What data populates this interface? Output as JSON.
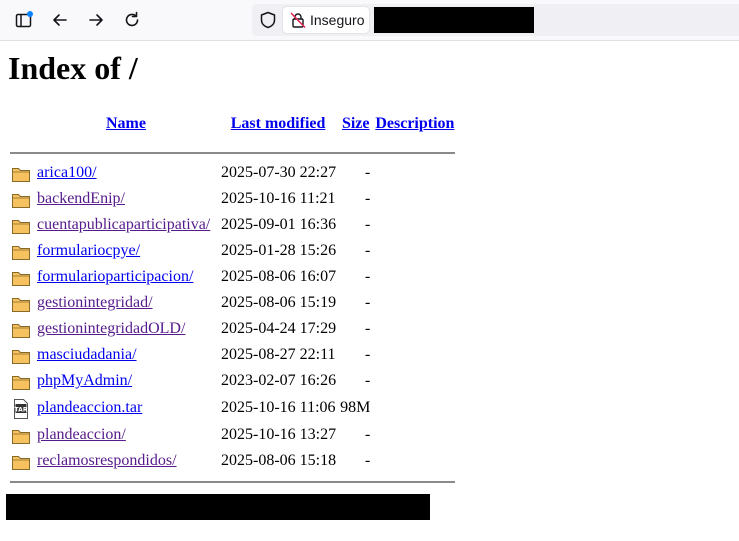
{
  "browser": {
    "security_label": "Inseguro"
  },
  "page": {
    "title": "Index of /"
  },
  "columns": {
    "name": "Name",
    "last_modified": "Last modified",
    "size": "Size",
    "description": "Description"
  },
  "entries": [
    {
      "name": "arica100/",
      "modified": "2025-07-30 22:27",
      "size": "-",
      "icon": "folder-icon",
      "visited": false
    },
    {
      "name": "backendEnip/",
      "modified": "2025-10-16 11:21",
      "size": "-",
      "icon": "folder-icon",
      "visited": true
    },
    {
      "name": "cuentapublicaparticipativa/",
      "modified": "2025-09-01 16:36",
      "size": "-",
      "icon": "folder-icon",
      "visited": true
    },
    {
      "name": "formulariocpye/",
      "modified": "2025-01-28 15:26",
      "size": "-",
      "icon": "folder-icon",
      "visited": false
    },
    {
      "name": "formularioparticipacion/",
      "modified": "2025-08-06 16:07",
      "size": "-",
      "icon": "folder-icon",
      "visited": false
    },
    {
      "name": "gestionintegridad/",
      "modified": "2025-08-06 15:19",
      "size": "-",
      "icon": "folder-icon",
      "visited": true
    },
    {
      "name": "gestionintegridadOLD/",
      "modified": "2025-04-24 17:29",
      "size": "-",
      "icon": "folder-icon",
      "visited": true
    },
    {
      "name": "masciudadania/",
      "modified": "2025-08-27 22:11",
      "size": "-",
      "icon": "folder-icon",
      "visited": false
    },
    {
      "name": "phpMyAdmin/",
      "modified": "2023-02-07 16:26",
      "size": "-",
      "icon": "folder-icon",
      "visited": false
    },
    {
      "name": "plandeaccion.tar",
      "modified": "2025-10-16 11:06",
      "size": "98M",
      "icon": "tar-file-icon",
      "visited": false
    },
    {
      "name": "plandeaccion/",
      "modified": "2025-10-16 13:27",
      "size": "-",
      "icon": "folder-icon",
      "visited": true
    },
    {
      "name": "reclamosrespondidos/",
      "modified": "2025-08-06 15:18",
      "size": "-",
      "icon": "folder-icon",
      "visited": true
    }
  ],
  "colors": {
    "link": "#0000ee",
    "visited_link": "#551a8b",
    "folder_fill": "#f5c25f",
    "folder_stroke": "#8a6a2a"
  }
}
